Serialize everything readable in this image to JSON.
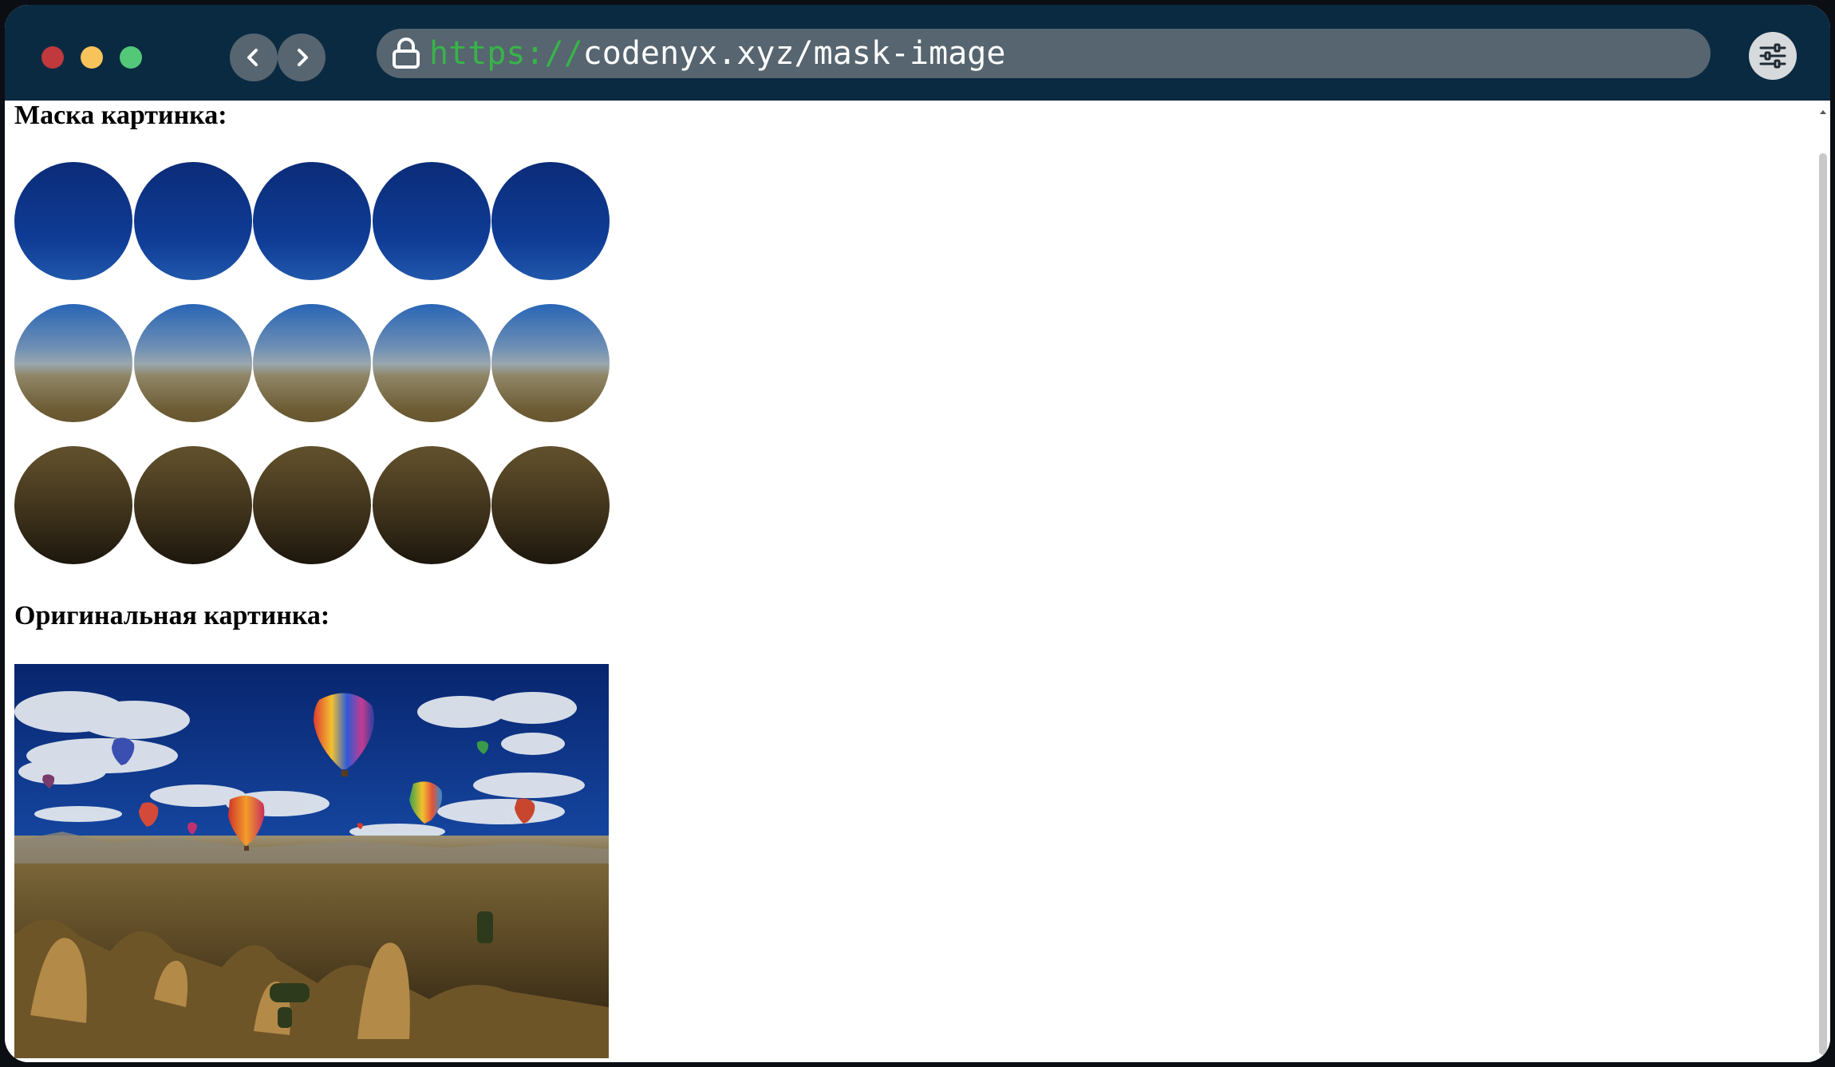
{
  "browser": {
    "url_scheme": "https://",
    "url_path": "codenyx.xyz/mask-image"
  },
  "page": {
    "mask_heading": "Маска картинка:",
    "original_heading": "Оригинальная картинка:"
  },
  "mask_grid": {
    "rows": 3,
    "cols": 5
  },
  "icons": {
    "back": "chevron-left-icon",
    "forward": "chevron-right-icon",
    "lock": "lock-icon",
    "menu": "sliders-icon"
  },
  "colors": {
    "toolbar": "#0a2a42",
    "urlbar": "#56656f",
    "scheme": "#38b449",
    "close": "#c0393d",
    "minimize": "#f7c35a",
    "maximize": "#53c879"
  }
}
